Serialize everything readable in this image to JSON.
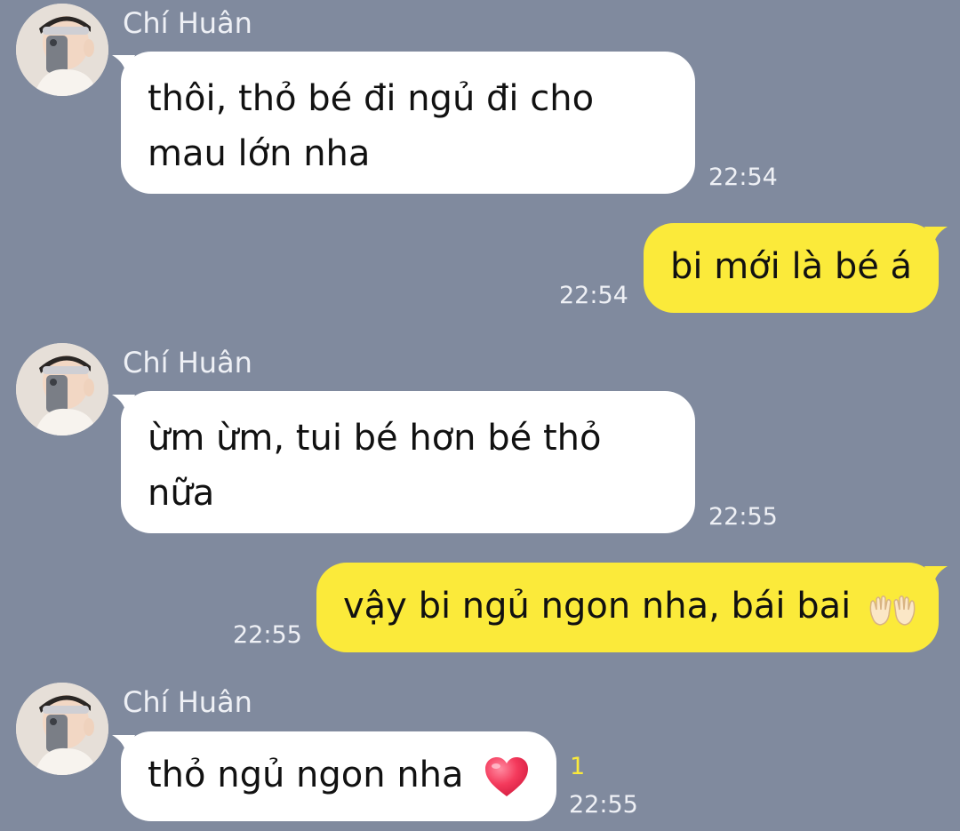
{
  "contact": {
    "name": "Chí Huân"
  },
  "messages": [
    {
      "direction": "incoming",
      "sender": "Chí Huân",
      "lines": [
        "thôi, thỏ bé đi ngủ đi cho",
        "mau lớn nha"
      ],
      "time": "22:54"
    },
    {
      "direction": "outgoing",
      "lines": [
        "bi mới là bé á"
      ],
      "time": "22:54"
    },
    {
      "direction": "incoming",
      "sender": "Chí Huân",
      "lines": [
        "ừm ừm, tui bé hơn bé thỏ",
        "nữa"
      ],
      "time": "22:55"
    },
    {
      "direction": "outgoing",
      "lines": [
        "vậy bi ngủ ngon nha, bái bai"
      ],
      "emoji": "raised-hands-emoji",
      "time": "22:55"
    },
    {
      "direction": "incoming",
      "sender": "Chí Huân",
      "lines": [
        "thỏ ngủ ngon nha"
      ],
      "emoji": "red-heart-emoji",
      "unread_count": "1",
      "time": "22:55"
    }
  ],
  "colors": {
    "background": "#808a9e",
    "incoming_bubble": "#ffffff",
    "outgoing_bubble": "#fbea3a",
    "unread_count": "#fbea3a",
    "meta_text": "#eef0f5"
  }
}
